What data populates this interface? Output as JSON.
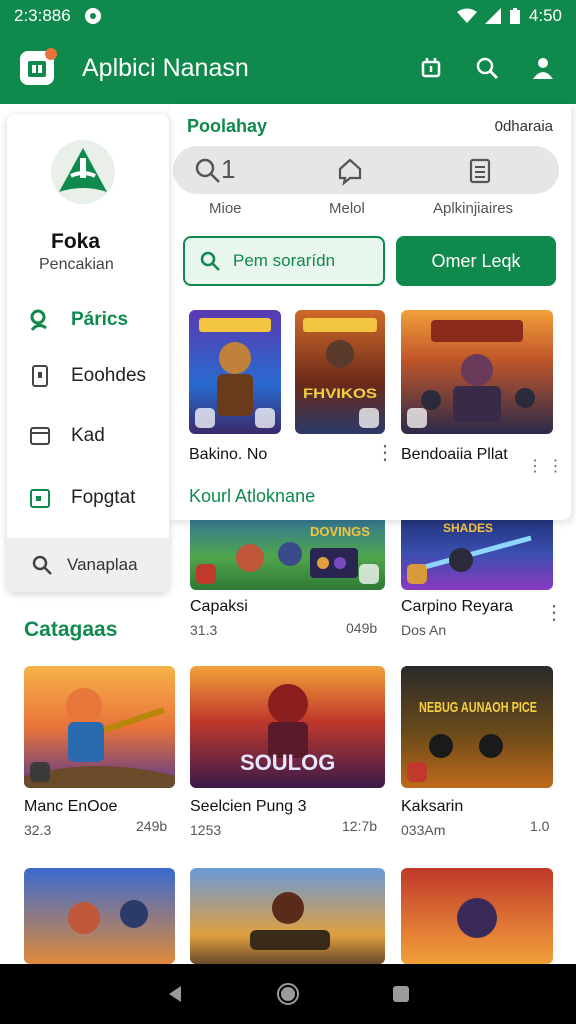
{
  "status": {
    "time": "2:3:886",
    "battery": "4:50"
  },
  "app": {
    "title": "Aplbici Nanasn"
  },
  "drawer": {
    "name": "Foka",
    "subtitle": "Pencakian",
    "items": [
      {
        "label": "Párics",
        "active": true
      },
      {
        "label": "Eoohdes"
      },
      {
        "label": "Kad"
      },
      {
        "label": "Fopgtat"
      }
    ],
    "search_label": "Vanaplaa"
  },
  "panel": {
    "header": "Poolahay",
    "header_right": "0dharaia",
    "count": "1",
    "seg_labels": [
      "Mioe",
      "Melol",
      "Aplkinjiaires"
    ],
    "btn_search": "Pem sorarídn",
    "btn_primary": "Omer Leqk",
    "cards": [
      {
        "name": "Bakino. No",
        "art": "a1"
      },
      {
        "name": "",
        "art": "a2"
      },
      {
        "name": "Bendoaiia Pllat",
        "art": "a3"
      }
    ],
    "more_link": "Kourl Atloknane"
  },
  "row2": [
    {
      "name": "Capaksi",
      "meta_left": "31.3",
      "meta_right": "049b"
    },
    {
      "name": "Carpino Reyara",
      "meta_left": "Dos An",
      "meta_right": ""
    }
  ],
  "section_title": "Catagaas",
  "grid": [
    {
      "name": "Manc EnOoe",
      "meta_left": "32.3",
      "meta_right": "249b"
    },
    {
      "name": "Seelcien Pung 3",
      "meta_left": "1253",
      "meta_right": "12:7b"
    },
    {
      "name": "Kaksarin",
      "meta_left": "033Am",
      "meta_right": "1.0"
    }
  ],
  "art_text": {
    "a2": "FHVIKOS",
    "r2a": "DOVINGS",
    "r2b": "SHADES",
    "g2": "SOULOG",
    "g3": "NEBUG AUNAOH PICE"
  }
}
